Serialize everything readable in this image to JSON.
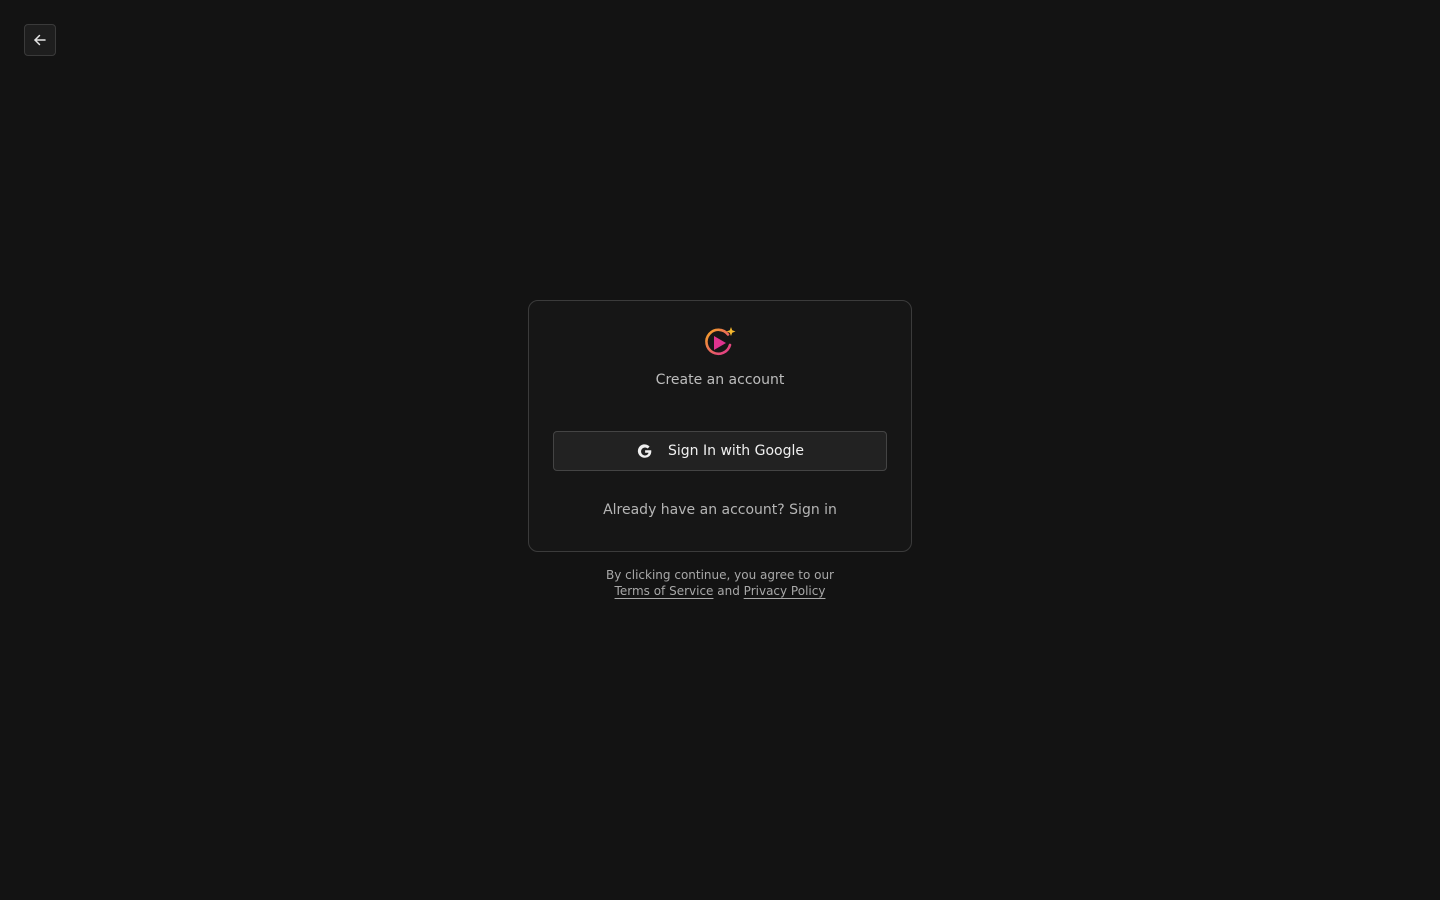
{
  "header": {
    "back_icon": "arrow-left-icon"
  },
  "card": {
    "logo_icon": "play-sparkle-logo-icon",
    "title": "Create an account",
    "google_button": {
      "icon": "google-g-icon",
      "label": "Sign In with Google"
    },
    "signin_prompt": "Already have an account?",
    "signin_link": "Sign in"
  },
  "legal": {
    "line1": "By clicking continue, you agree to our",
    "terms_link": "Terms of Service",
    "and_text": "and",
    "privacy_link": "Privacy Policy"
  },
  "colors": {
    "background": "#131313",
    "card_border": "#3b3b3b",
    "logo_gradient_start": "#f5a623",
    "logo_gradient_end": "#e0338f",
    "sparkle": "#f5b82e"
  }
}
